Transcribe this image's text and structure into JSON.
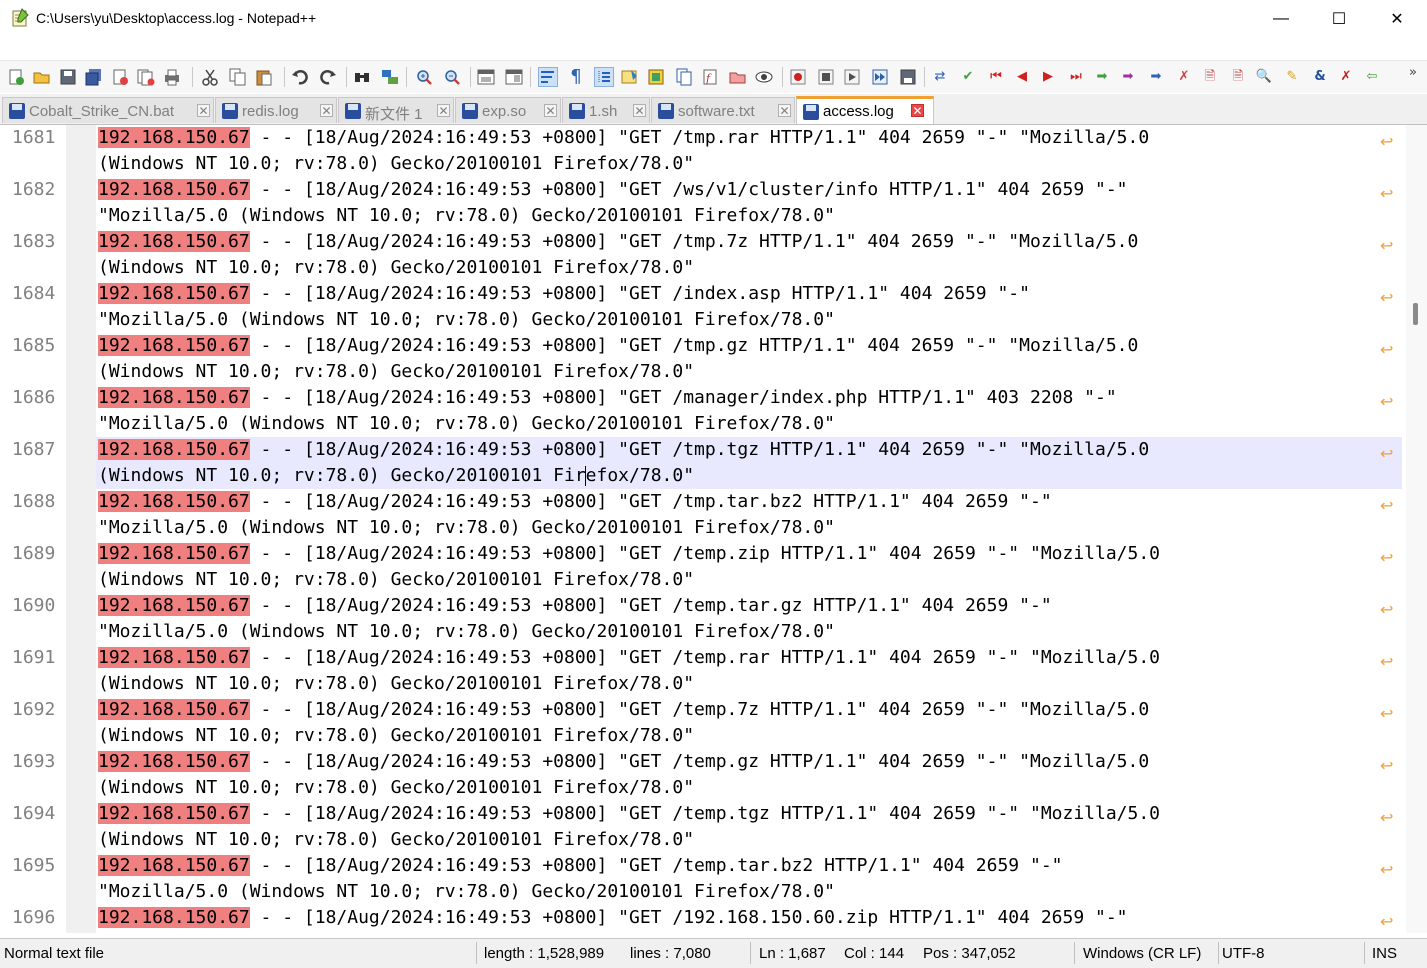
{
  "window": {
    "title": "C:\\Users\\yu\\Desktop\\access.log - Notepad++",
    "minimize": "—",
    "maximize": "☐",
    "close": "✕"
  },
  "toolbar": {
    "overflow": "»"
  },
  "tabs": [
    {
      "label": "Cobalt_Strike_CN.bat",
      "active": false
    },
    {
      "label": "redis.log",
      "active": false
    },
    {
      "label": "新文件 1",
      "active": false
    },
    {
      "label": "exp.so",
      "active": false
    },
    {
      "label": "1.sh",
      "active": false
    },
    {
      "label": "software.txt",
      "active": false
    },
    {
      "label": "access.log",
      "active": true
    }
  ],
  "tab_close_glyph": "✕",
  "wrap_glyph": "↩",
  "editor": {
    "ip": "192.168.150.67",
    "current_line": 1687,
    "lines": [
      {
        "no": "1681",
        "w1": " - - [18/Aug/2024:16:49:53 +0800] \"GET /tmp.rar HTTP/1.1\" 404 2659 \"-\" \"Mozilla/5.0",
        "w2": "(Windows NT 10.0; rv:78.0) Gecko/20100101 Firefox/78.0\""
      },
      {
        "no": "1682",
        "w1": " - - [18/Aug/2024:16:49:53 +0800] \"GET /ws/v1/cluster/info HTTP/1.1\" 404 2659 \"-\"",
        "w2": "\"Mozilla/5.0 (Windows NT 10.0; rv:78.0) Gecko/20100101 Firefox/78.0\""
      },
      {
        "no": "1683",
        "w1": " - - [18/Aug/2024:16:49:53 +0800] \"GET /tmp.7z HTTP/1.1\" 404 2659 \"-\" \"Mozilla/5.0",
        "w2": "(Windows NT 10.0; rv:78.0) Gecko/20100101 Firefox/78.0\""
      },
      {
        "no": "1684",
        "w1": " - - [18/Aug/2024:16:49:53 +0800] \"GET /index.asp HTTP/1.1\" 404 2659 \"-\"",
        "w2": "\"Mozilla/5.0 (Windows NT 10.0; rv:78.0) Gecko/20100101 Firefox/78.0\""
      },
      {
        "no": "1685",
        "w1": " - - [18/Aug/2024:16:49:53 +0800] \"GET /tmp.gz HTTP/1.1\" 404 2659 \"-\" \"Mozilla/5.0",
        "w2": "(Windows NT 10.0; rv:78.0) Gecko/20100101 Firefox/78.0\""
      },
      {
        "no": "1686",
        "w1": " - - [18/Aug/2024:16:49:53 +0800] \"GET /manager/index.php HTTP/1.1\" 403 2208 \"-\"",
        "w2": "\"Mozilla/5.0 (Windows NT 10.0; rv:78.0) Gecko/20100101 Firefox/78.0\""
      },
      {
        "no": "1687",
        "w1": " - - [18/Aug/2024:16:49:53 +0800] \"GET /tmp.tgz HTTP/1.1\" 404 2659 \"-\" \"Mozilla/5.0",
        "w2a": "(Windows NT 10.0; rv:78.0) Gecko/20100101 Fir",
        "w2b": "efox/78.0\""
      },
      {
        "no": "1688",
        "w1": " - - [18/Aug/2024:16:49:53 +0800] \"GET /tmp.tar.bz2 HTTP/1.1\" 404 2659 \"-\"",
        "w2": "\"Mozilla/5.0 (Windows NT 10.0; rv:78.0) Gecko/20100101 Firefox/78.0\""
      },
      {
        "no": "1689",
        "w1": " - - [18/Aug/2024:16:49:53 +0800] \"GET /temp.zip HTTP/1.1\" 404 2659 \"-\" \"Mozilla/5.0",
        "w2": "(Windows NT 10.0; rv:78.0) Gecko/20100101 Firefox/78.0\""
      },
      {
        "no": "1690",
        "w1": " - - [18/Aug/2024:16:49:53 +0800] \"GET /temp.tar.gz HTTP/1.1\" 404 2659 \"-\"",
        "w2": "\"Mozilla/5.0 (Windows NT 10.0; rv:78.0) Gecko/20100101 Firefox/78.0\""
      },
      {
        "no": "1691",
        "w1": " - - [18/Aug/2024:16:49:53 +0800] \"GET /temp.rar HTTP/1.1\" 404 2659 \"-\" \"Mozilla/5.0",
        "w2": "(Windows NT 10.0; rv:78.0) Gecko/20100101 Firefox/78.0\""
      },
      {
        "no": "1692",
        "w1": " - - [18/Aug/2024:16:49:53 +0800] \"GET /temp.7z HTTP/1.1\" 404 2659 \"-\" \"Mozilla/5.0",
        "w2": "(Windows NT 10.0; rv:78.0) Gecko/20100101 Firefox/78.0\""
      },
      {
        "no": "1693",
        "w1": " - - [18/Aug/2024:16:49:53 +0800] \"GET /temp.gz HTTP/1.1\" 404 2659 \"-\" \"Mozilla/5.0",
        "w2": "(Windows NT 10.0; rv:78.0) Gecko/20100101 Firefox/78.0\""
      },
      {
        "no": "1694",
        "w1": " - - [18/Aug/2024:16:49:53 +0800] \"GET /temp.tgz HTTP/1.1\" 404 2659 \"-\" \"Mozilla/5.0",
        "w2": "(Windows NT 10.0; rv:78.0) Gecko/20100101 Firefox/78.0\""
      },
      {
        "no": "1695",
        "w1": " - - [18/Aug/2024:16:49:53 +0800] \"GET /temp.tar.bz2 HTTP/1.1\" 404 2659 \"-\"",
        "w2": "\"Mozilla/5.0 (Windows NT 10.0; rv:78.0) Gecko/20100101 Firefox/78.0\""
      },
      {
        "no": "1696",
        "w1": " - - [18/Aug/2024:16:49:53 +0800] \"GET /192.168.150.60.zip HTTP/1.1\" 404 2659 \"-\"",
        "w2": ""
      }
    ]
  },
  "status": {
    "file_type": "Normal text file",
    "length": "length : 1,528,989",
    "lines": "lines : 7,080",
    "ln": "Ln : 1,687",
    "col": "Col : 144",
    "pos": "Pos : 347,052",
    "eol": "Windows (CR LF)",
    "encoding": "UTF-8",
    "mode": "INS"
  },
  "colors": {
    "ip_highlight": "#f08080",
    "current_line": "#e8e8ff",
    "wrap_symbol": "#f0a040",
    "line_number": "#808080",
    "active_tab_accent": "#f0a030"
  }
}
